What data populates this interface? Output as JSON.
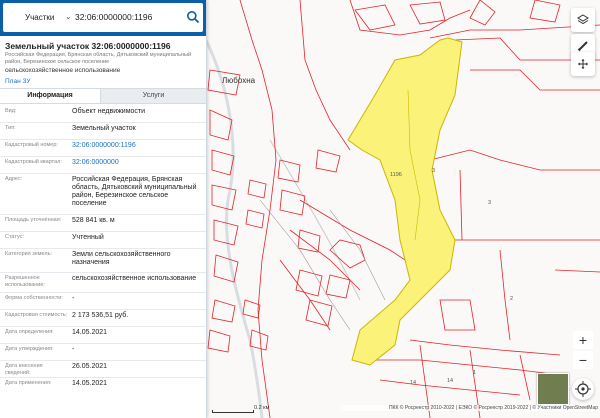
{
  "search": {
    "type_label": "Участки",
    "query": "32:06:0000000:1196"
  },
  "card": {
    "title": "Земельный участок 32:06:0000000:1196",
    "address": "Российская Федерация, Брянская область, Дятьковский муниципальный район, Березинское сельское поселение",
    "use": "сельскохозяйственное использование",
    "plan_link": "План ЗУ"
  },
  "tabs": [
    {
      "label": "Информация"
    },
    {
      "label": "Услуги"
    }
  ],
  "fields": [
    {
      "key": "Вид:",
      "value": "Объект недвижимости"
    },
    {
      "key": "Тип:",
      "value": "Земельный участок"
    },
    {
      "key": "Кадастровый номер:",
      "value": "32:06:0000000:1196"
    },
    {
      "key": "Кадастровый квартал:",
      "value": "32:06:0000000"
    },
    {
      "key": "Адрес:",
      "value": "Российская Федерация, Брянская область, Дятьковский муниципальный район, Березинское сельское поселение"
    },
    {
      "key": "Площадь уточнённая:",
      "value": "528 841 кв. м"
    },
    {
      "key": "Статус:",
      "value": "Учтенный"
    },
    {
      "key": "Категория земель:",
      "value": "Земли сельскохозяйственного назначения"
    },
    {
      "key": "Разрешенное использование:",
      "value": "сельскохозяйственное использование"
    },
    {
      "key": "Форма собственности:",
      "value": "-"
    },
    {
      "key": "Кадастровая стоимость:",
      "value": "2 173 536,51 руб."
    },
    {
      "key": "Дата определения:",
      "value": "14.05.2021"
    },
    {
      "key": "Дата утверждения:",
      "value": "-"
    },
    {
      "key": "Дата внесения сведений:",
      "value": "26.05.2021"
    },
    {
      "key": "Дата применения:",
      "value": "14.05.2021"
    }
  ],
  "map": {
    "village_label": "Любохна",
    "parcel_label": "1196",
    "plot_numbers": [
      "3",
      "3",
      "14",
      "14",
      "1",
      "2"
    ],
    "scale_label": "0.2 км",
    "attribution": "ПКК © Росреестр 2010-2022 | ЕЭКО © Росреестр 2019-2022 | © Участники OpenStreetMap"
  },
  "controls": {
    "zoom_in": "+",
    "zoom_out": "−"
  },
  "colors": {
    "header": "#0b5fa8",
    "parcel_fill": "#fbf27a",
    "parcel_stroke": "#c9b800",
    "boundary": "#e2242b",
    "link": "#1f6fc1"
  },
  "icons": [
    "search-icon",
    "chevron-down-icon",
    "layers-icon",
    "ruler-icon",
    "move-icon",
    "locate-icon"
  ]
}
